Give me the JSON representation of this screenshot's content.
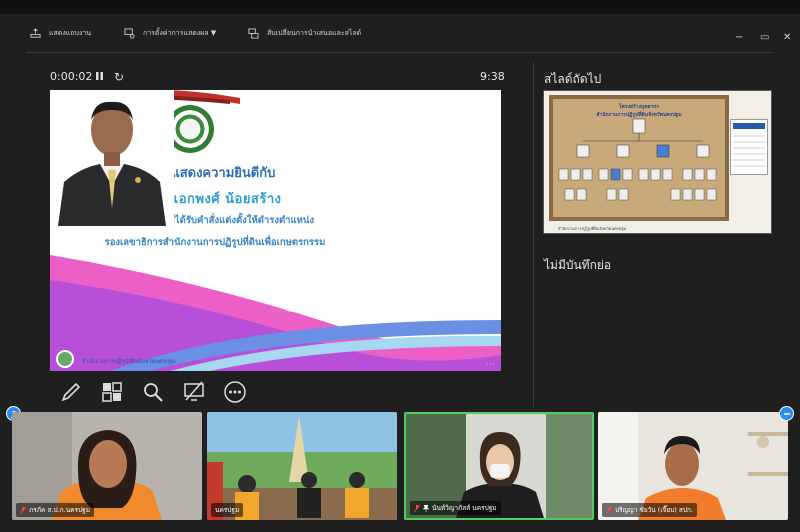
{
  "toolbar": {
    "item1": "แสดงแถบงาน",
    "item2": "การตั้งค่าการแสดงผล ▼",
    "item3": "สับเปลี่ยนการนำเสนอและสไลด์",
    "win_min": "−",
    "win_max": "▭",
    "win_close": "✕"
  },
  "presenter": {
    "timer": "0:00:02",
    "clock": "9:38",
    "next_slide_label": "สไลด์ถัดไป",
    "notes_label": "ไม่มีบันทึกย่อ"
  },
  "slide": {
    "line1": "ขอแสดงความยินดีกับ",
    "line2": "นายเอกพงศ์   น้อยสร้าง",
    "line3": "เนื่องในโอกาสได้รับคำสั่งแต่งตั้งให้ดำรงตำแหน่ง",
    "line4": "รองเลขาธิการสำนักงานการปฏิรูปที่ดินเพื่อเกษตรกรรม",
    "footer": "สำนักงานการปฏิรูปที่ดินจังหวัดนครปฐม"
  },
  "next_slide": {
    "title1": "โครงสร้างบุคลากร",
    "title2": "สำนักงานการปฏิรูปที่ดินจังหวัดนครปฐม",
    "footer": "สำนักงานการปฏิรูปที่ดินจังหวัดนครปฐม"
  },
  "tools": {
    "icons": [
      "pen-icon",
      "slides-grid-icon",
      "zoom-icon",
      "screen-off-icon",
      "more-options-icon"
    ]
  },
  "participants": [
    {
      "name": "ภรภัค ส.ป.ก.นครปฐม",
      "muted": true
    },
    {
      "name": "นครปฐม",
      "muted": false
    },
    {
      "name": "นันท์วิญาภัสส์ นครปฐม",
      "muted": true
    },
    {
      "name": "ปริญญา ชัยวัน (เจี๊ยบ) สปก.",
      "muted": true
    }
  ],
  "colors": {
    "accent_active": "#4fcf5f",
    "bubble": "#2d8cf0",
    "slide_title": "#2f6fb4"
  }
}
